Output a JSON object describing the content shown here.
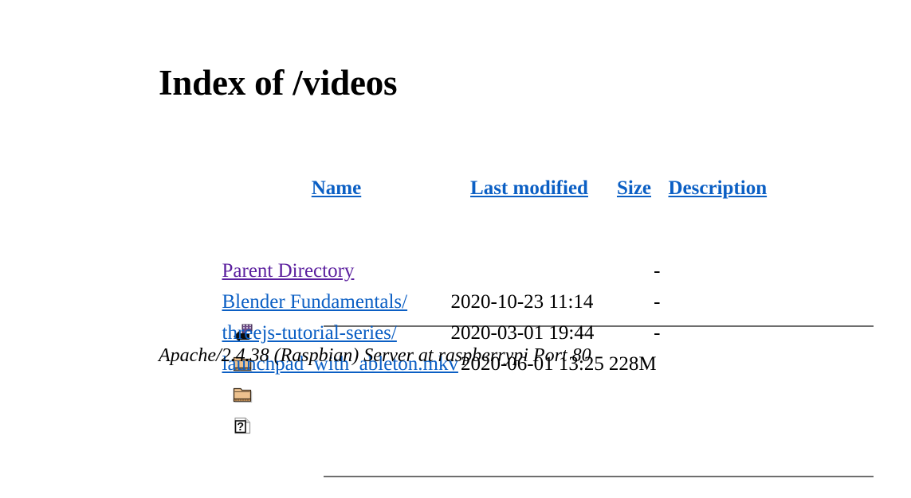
{
  "page": {
    "title": "Index of /videos",
    "directory": "/videos"
  },
  "table": {
    "headers": {
      "name": "Name",
      "last_modified": "Last modified",
      "size": "Size",
      "description": "Description"
    },
    "parent": {
      "icon": "back-arrow-icon",
      "label": "Parent Directory",
      "last_modified": "",
      "size": "-",
      "description": ""
    },
    "rows": [
      {
        "icon": "folder-icon",
        "name": "Blender Fundamentals/",
        "last_modified": "2020-10-23 11:14",
        "size": "-",
        "description": ""
      },
      {
        "icon": "folder-icon",
        "name": "threejs-tutorial-series/",
        "last_modified": "2020-03-01 19:44",
        "size": "-",
        "description": ""
      },
      {
        "icon": "unknown-file-icon",
        "name": "launchpad_with_ableton.mkv",
        "last_modified": "2020-06-01 13:25",
        "size": "228M",
        "description": ""
      }
    ]
  },
  "footer": {
    "text": "Apache/2.4.38 (Raspbian) Server at raspberrypi Port 80"
  },
  "colors": {
    "link": "#0b5fc4",
    "visited_link": "#5b1f9e",
    "rule": "#6e6e6e",
    "text": "#000000",
    "background": "#ffffff",
    "folder_face": "#e8bf86",
    "folder_shadow": "#c0895a"
  }
}
